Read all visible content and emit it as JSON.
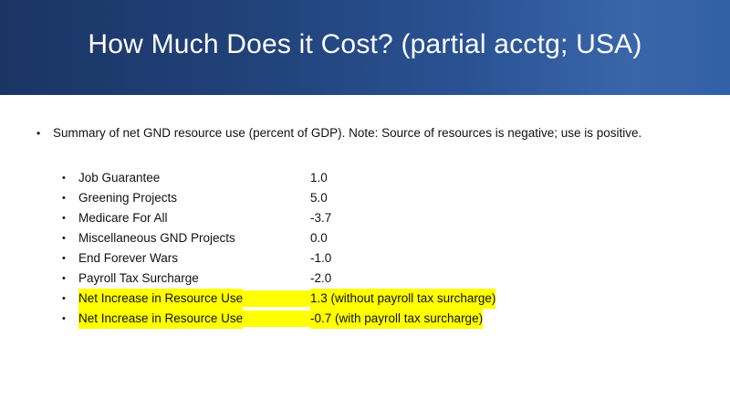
{
  "slide": {
    "title": "How Much Does it Cost? (partial acctg; USA)",
    "intro_bullet": "•",
    "intro": "Summary of net GND resource use (percent of GDP). Note: Source of resources is negative; use is positive.",
    "sub_bullet": "•",
    "items": [
      {
        "label": "Job Guarantee",
        "value": "1.0",
        "highlighted": false
      },
      {
        "label": "Greening Projects",
        "value": "5.0",
        "highlighted": false
      },
      {
        "label": "Medicare For All",
        "value": "-3.7",
        "highlighted": false
      },
      {
        "label": "Miscellaneous GND Projects",
        "value": "0.0",
        "highlighted": false
      },
      {
        "label": "End Forever Wars",
        "value": "-1.0",
        "highlighted": false
      },
      {
        "label": "Payroll Tax Surcharge",
        "value": "-2.0",
        "highlighted": false
      },
      {
        "label": "Net Increase in Resource Use",
        "value": "1.3 (without payroll tax surcharge)",
        "highlighted": true
      },
      {
        "label": "Net Increase in Resource Use",
        "value": "-0.7 (with payroll tax surcharge)",
        "highlighted": true
      }
    ],
    "colors": {
      "header_dark": "#1a3564",
      "header_light": "#2d5ca4",
      "highlight": "#ffff00",
      "text": "#111111"
    }
  }
}
